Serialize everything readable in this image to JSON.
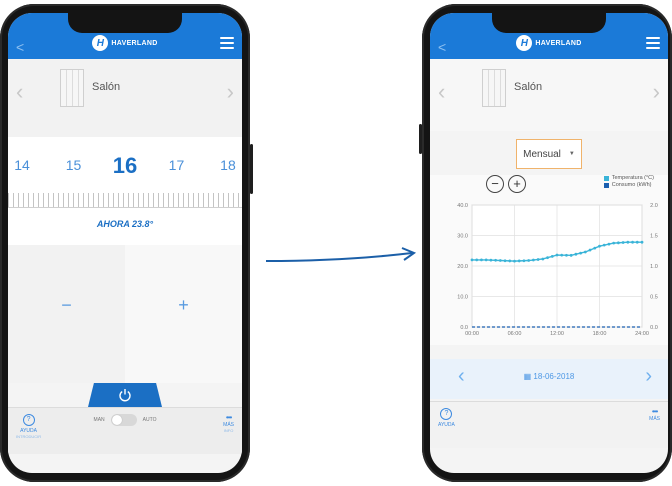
{
  "left_phone": {
    "brand": "HAVERLAND",
    "back": "<",
    "device_name": "Salón",
    "temps": [
      "14",
      "15",
      "16",
      "17",
      "18"
    ],
    "current_temp": "16",
    "now_label": "AHORA 23.8°",
    "minus": "−",
    "plus": "+",
    "power_icon": "power-icon",
    "help_label": "AYUDA",
    "help_sub": "INTRODUCIR",
    "mode_manual": "MAN",
    "mode_auto": "AUTO",
    "more_label": "MÁS",
    "more_sub": "INFO"
  },
  "right_phone": {
    "brand": "HAVERLAND",
    "back": "<",
    "device_name": "Salón",
    "period_select": "Mensual",
    "legend": [
      "Temperatura (°C)",
      "Consumo (kWh)"
    ],
    "help_label": "AYUDA",
    "more_label": "MÁS",
    "date": "18-06-2018"
  },
  "chart_data": {
    "type": "line",
    "x": [
      "00:00",
      "02:00",
      "04:00",
      "06:00",
      "08:00",
      "10:00",
      "12:00",
      "14:00",
      "16:00",
      "18:00",
      "20:00",
      "22:00",
      "24:00"
    ],
    "series": [
      {
        "name": "Temperatura (°C)",
        "values": [
          22.0,
          22.0,
          21.8,
          21.6,
          21.8,
          22.3,
          23.6,
          23.5,
          24.6,
          26.5,
          27.5,
          27.8,
          27.8
        ]
      },
      {
        "name": "Consumo (kWh)",
        "values": [
          0,
          0,
          0,
          0,
          0,
          0,
          0,
          0,
          0,
          0,
          0,
          0,
          0
        ]
      }
    ],
    "y_ticks": [
      "0.0",
      "10.0",
      "20.0",
      "30.0",
      "40.0"
    ],
    "y2_ticks": [
      "0.0",
      "0.5",
      "1.0",
      "1.5",
      "2.0"
    ],
    "x_ticks": [
      "00:00",
      "06:00",
      "12:00",
      "18:00",
      "24:00"
    ],
    "ylim": [
      0,
      40
    ],
    "y2lim": [
      0,
      2
    ],
    "zoom_out": "−",
    "zoom_in": "+",
    "colors": {
      "temperature": "#3ab4d8",
      "consumption": "#1a5fb0"
    }
  }
}
